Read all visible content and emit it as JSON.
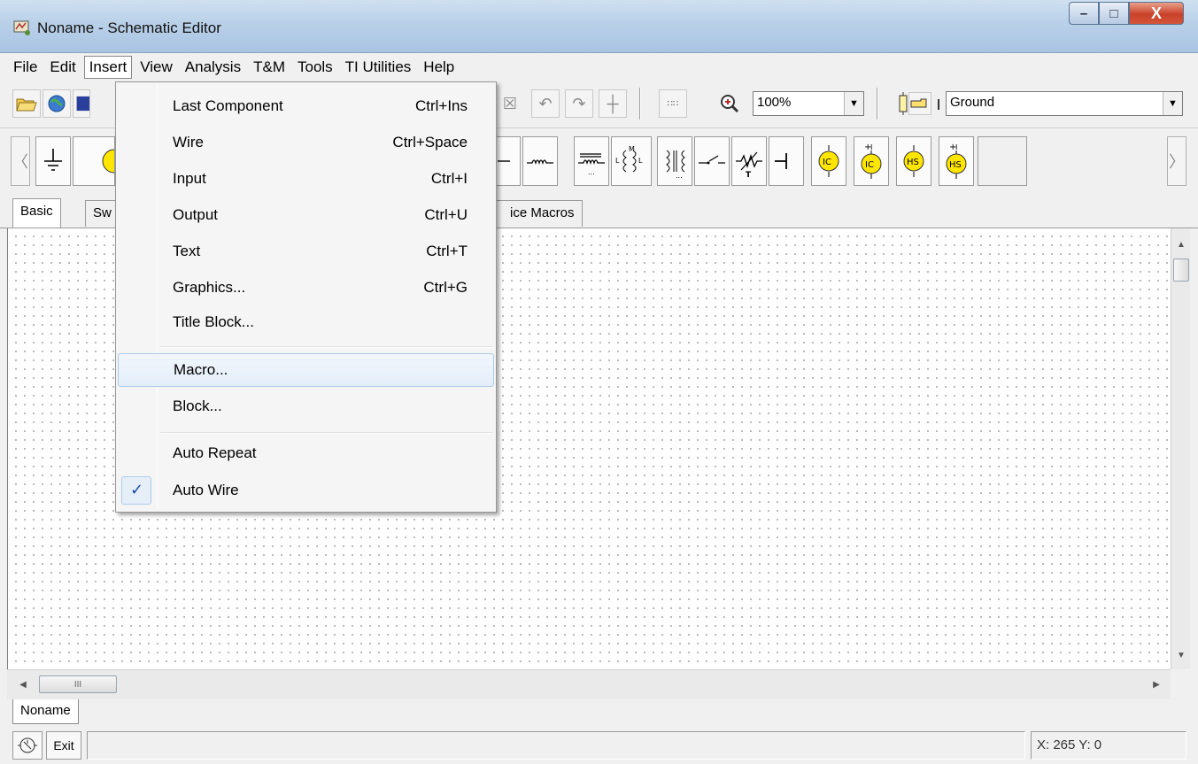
{
  "window": {
    "title": "Noname - Schematic Editor",
    "controls": {
      "minimize": "–",
      "maximize": "□",
      "close": "X"
    }
  },
  "menubar": {
    "items": [
      "File",
      "Edit",
      "Insert",
      "View",
      "Analysis",
      "T&M",
      "Tools",
      "TI Utilities",
      "Help"
    ],
    "open_menu": "Insert"
  },
  "toolbar": {
    "zoom_value": "100%",
    "component_value": "Ground",
    "zoom_icon": "zoom-in-icon"
  },
  "palette": {
    "buttons": [
      "ground",
      "voltage-source",
      "inductor",
      "inductor-core",
      "mutual-inductor",
      "transformer",
      "switch",
      "potentiometer",
      "capacitor",
      "current-probe-ic",
      "current-probe-ic-plus",
      "probe-hs",
      "probe-hs-plus"
    ]
  },
  "component_tabs": {
    "basic": "Basic",
    "switches_partial": "Sw",
    "spice_macros_partial": "ice Macros"
  },
  "insert_menu": {
    "items": [
      {
        "label": "Last Component",
        "shortcut": "Ctrl+Ins"
      },
      {
        "label": "Wire",
        "shortcut": "Ctrl+Space"
      },
      {
        "label": "Input",
        "shortcut": "Ctrl+I"
      },
      {
        "label": "Output",
        "shortcut": "Ctrl+U"
      },
      {
        "label": "Text",
        "shortcut": "Ctrl+T"
      },
      {
        "label": "Graphics...",
        "shortcut": "Ctrl+G"
      },
      {
        "label": "Title Block...",
        "shortcut": ""
      },
      {
        "label": "Macro...",
        "shortcut": ""
      },
      {
        "label": "Block...",
        "shortcut": ""
      },
      {
        "label": "Auto Repeat",
        "shortcut": ""
      },
      {
        "label": "Auto Wire",
        "shortcut": "",
        "checked": true
      }
    ],
    "highlighted": "Macro...",
    "check_mark": "✓"
  },
  "scrollbar": {
    "h_thumb_grip": "III"
  },
  "document_tabs": [
    "Noname"
  ],
  "statusbar": {
    "exit_label": "Exit",
    "coordinates": "X: 265 Y: 0"
  },
  "colors": {
    "titlebar": "#b9d0e8",
    "close_button": "#c9412a",
    "menu_highlight": "#e4eef9",
    "probe_yellow": "#ffe600",
    "check_blue": "#1a4fa3"
  }
}
